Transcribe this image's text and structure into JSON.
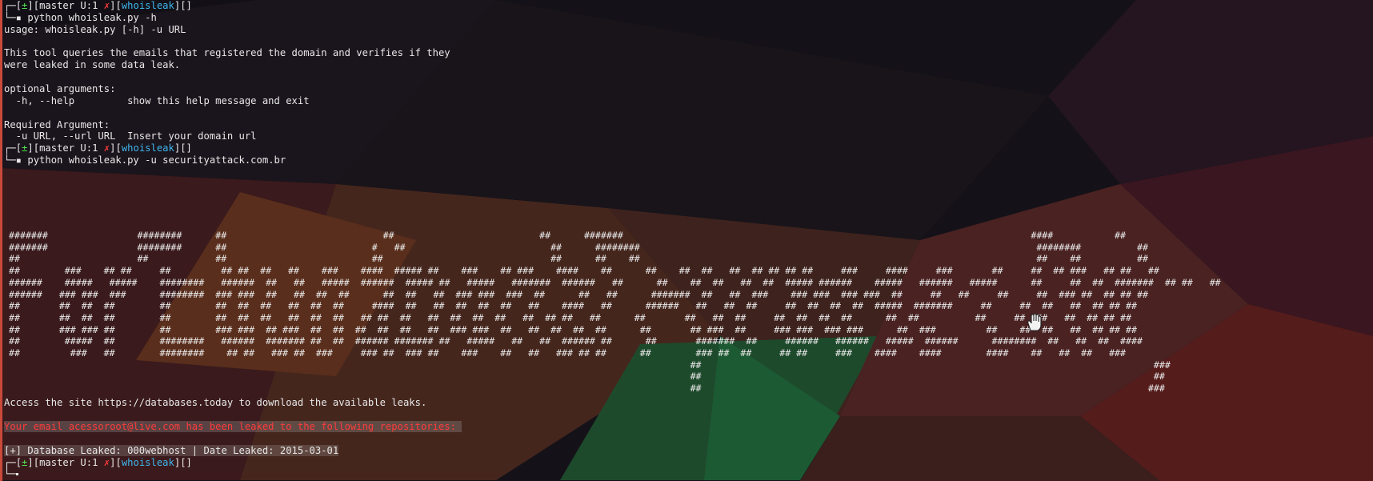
{
  "terminal": {
    "prompt": {
      "open": "[",
      "mark": "±",
      "close": "][",
      "branch": "master U:1 ",
      "x": "✗",
      "dir_open": "][",
      "dir": "whoisleak",
      "tail": "][]"
    },
    "cmd1": "python whoisleak.py -h",
    "help": [
      "usage: whoisleak.py [-h] -u URL",
      "This tool queries the emails that registered the domain and verifies if they",
      "were leaked in some data leak.",
      "optional arguments:",
      "  -h, --help         show this help message and exit",
      "Required Argument:",
      "  -u URL, --url URL  Insert your domain url"
    ],
    "cmd2": "python whoisleak.py -u securityattack.com.br",
    "banner": [
      "#######                ########      ##                            ##                          ##      #######                                                                         ####           ##",
      "#######                ########      ##                          #   ##                          ##      ########                                                                       ########          ##",
      "##                     ##            ##                          ##                              ##      ##    ##                                                                       ##    ##          ##",
      "##        ###    ## ##     ##         ## ##  ##   ##    ###    ####  ##### ##    ###    ## ###    ####    ##      ##    ##  ##   ##  ## ## ## ##     ###     ####     ###       ##     ##  ## ###   ## ##   ##",
      "######    #####   #####    ########   ######  ##   ##   #####  ######  ##### ##   #####   #######  ######   ##      ##    ##  ##   ##  ##  ##### ######    #####   ######   #####      ##     ##  ##  #######  ## ##   ##",
      "######   ### ###  ###      ########  ### ###  ##   ##  ##  ##      ##  ##   ##  ### ###  ###  ##      ##   ##      #######  ##   ##  ###    ### ###  ### ###  ##     ##   ##     ##     ##  ### ##  ## ## ##",
      "##       ##  ##  ##        ##        ##  ##  ##   ##  ##  ##     ####  ##   ##  ##  ##  ##   ##    ####   ##      ######   ##   ##  ##     ##  ##  ##  ##  #####  #######     ##     ##  ##   ##  ## ## ##",
      "##       ##  ##  ##        ##        ##  ##  ##   ##  ##  ##   ## ##  ##   ##  ##  ##  ##   ##  ## ##   ##      ##       ##   ##  ##     ##  ##  ##  ##      ##  ##          ##     ##  ##   ##  ## ## ##",
      "##       ### ### ##        ##        ### ###  ## ###  ##  ##  ##  ##  ##   ##  ### ###  ##   ##  ##  ##  ##      ##       ## ###  ##     ### ###  ### ###      ##  ###         ##    ##  ##   ##  ## ## ##",
      "##        #####  ##        ########   ######  ####### ##  ##  ###### ####### ##   #####   ##   ##  ###### ##      ##       #######  ##     ######   ######   #####  ######      ########  ##   ##  ##  ####",
      "##         ###   ##        ########    ## ##   ### ##  ###     ### ##  ### ##    ###    ##   ##   ### ## ##      ##        ### ##  ##     ## ##     ###    ####    ####        ####    ##   ##  ##   ###",
      "                                                                                                                          ##                                                                                 ###",
      "                                                                                                                          ##                                                                                 ##",
      "                                                                                                                          ##                                                                                ###"
    ],
    "access": "Access the site https://databases.today to download the available leaks.",
    "leak_msg": "Your email acessoroot@live.com has been leaked to the following repositories: ",
    "db_line": "[+] Database Leaked: 000webhost | Date Leaked: 2015-03-01"
  },
  "colors": {
    "background": "#141218",
    "text": "#e8e8e8",
    "prompt_mark": "#4fe24f",
    "branch_x": "#ff3b3b",
    "directory": "#3fb6ee",
    "leak_message": "#ff3b3b"
  }
}
